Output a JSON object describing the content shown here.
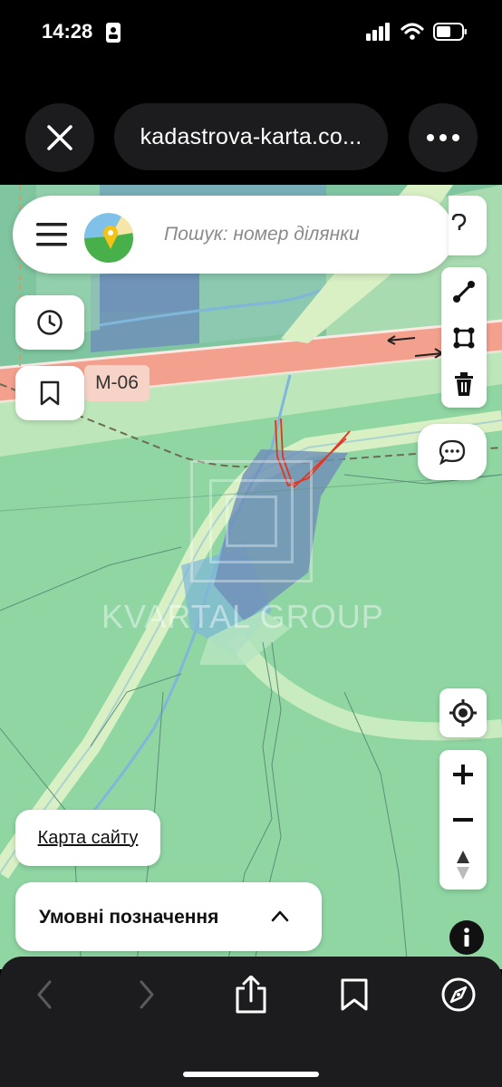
{
  "status_bar": {
    "time": "14:28",
    "icons": [
      "id-card-icon",
      "signal-icon",
      "wifi-icon",
      "battery-icon"
    ]
  },
  "browser": {
    "url": "kadastrova-karta.co...",
    "close_icon": "close-icon",
    "menu_icon": "ellipsis-icon"
  },
  "map": {
    "search_placeholder": "Пошук: номер ділянки",
    "road_label": "М-06",
    "watermark": "KVARTAL GROUP",
    "colors": {
      "base_green": "#8fd6a3",
      "road": "#f4a08e",
      "water": "#7fb6d9",
      "parcel": "#6f8fb8",
      "red_boundary": "#e8321e"
    },
    "tools": [
      "line-tool-icon",
      "polygon-tool-icon",
      "trash-icon"
    ],
    "zoom": [
      "zoom-in-icon",
      "zoom-out-icon",
      "compass-icon"
    ]
  },
  "controls": {
    "history_icon": "clock-icon",
    "bookmark_icon": "bookmark-icon",
    "chat_icon": "chat-icon",
    "locate_icon": "locate-icon",
    "sitemap_label": "Карта сайту",
    "legend_label": "Умовні позначення",
    "info_icon": "info-icon"
  },
  "bottom_bar": {
    "icons": [
      "back-icon",
      "forward-icon",
      "share-icon",
      "bookmarks-icon",
      "safari-compass-icon"
    ]
  }
}
